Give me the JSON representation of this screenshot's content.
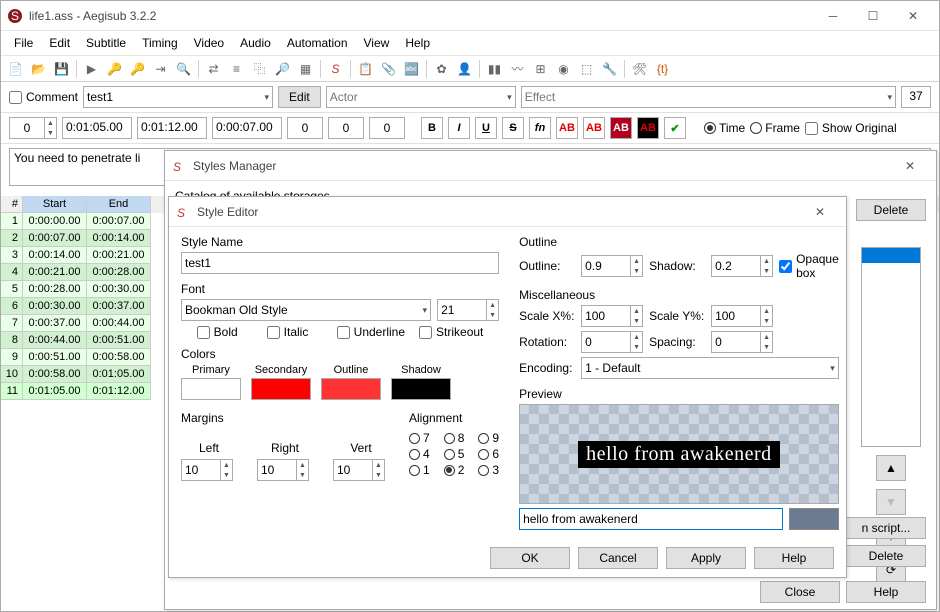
{
  "main": {
    "title": "life1.ass - Aegisub 3.2.2",
    "menus": [
      "File",
      "Edit",
      "Subtitle",
      "Timing",
      "Video",
      "Audio",
      "Automation",
      "View",
      "Help"
    ],
    "comment_label": "Comment",
    "style_selected": "test1",
    "edit_btn": "Edit",
    "actor_placeholder": "Actor",
    "effect_placeholder": "Effect",
    "layer": "37",
    "row": {
      "l": "0",
      "start": "0:01:05.00",
      "end": "0:01:12.00",
      "dur": "0:00:07.00",
      "m1": "0",
      "m2": "0",
      "m3": "0"
    },
    "time_label": "Time",
    "frame_label": "Frame",
    "show_orig": "Show Original",
    "text": "You need to penetrate li",
    "grid_headers": [
      "#",
      "Start",
      "End"
    ],
    "grid": [
      {
        "n": "1",
        "s": "0:00:00.00",
        "e": "0:00:07.00"
      },
      {
        "n": "2",
        "s": "0:00:07.00",
        "e": "0:00:14.00"
      },
      {
        "n": "3",
        "s": "0:00:14.00",
        "e": "0:00:21.00"
      },
      {
        "n": "4",
        "s": "0:00:21.00",
        "e": "0:00:28.00"
      },
      {
        "n": "5",
        "s": "0:00:28.00",
        "e": "0:00:30.00"
      },
      {
        "n": "6",
        "s": "0:00:30.00",
        "e": "0:00:37.00"
      },
      {
        "n": "7",
        "s": "0:00:37.00",
        "e": "0:00:44.00"
      },
      {
        "n": "8",
        "s": "0:00:44.00",
        "e": "0:00:51.00"
      },
      {
        "n": "9",
        "s": "0:00:51.00",
        "e": "0:00:58.00"
      },
      {
        "n": "10",
        "s": "0:00:58.00",
        "e": "0:01:05.00"
      },
      {
        "n": "11",
        "s": "0:01:05.00",
        "e": "0:01:12.00"
      }
    ]
  },
  "styles_manager": {
    "title": "Styles Manager",
    "catalog": "Catalog of available storages",
    "delete": "Delete",
    "script": "n script...",
    "delete2": "Delete",
    "close": "Close",
    "help": "Help"
  },
  "style_editor": {
    "title": "Style Editor",
    "style_name_label": "Style Name",
    "style_name": "test1",
    "font_label": "Font",
    "font_name": "Bookman Old Style",
    "font_size": "21",
    "bold": "Bold",
    "italic": "Italic",
    "underline": "Underline",
    "strikeout": "Strikeout",
    "colors_label": "Colors",
    "color_labels": [
      "Primary",
      "Secondary",
      "Outline",
      "Shadow"
    ],
    "colors": [
      "#ffffff",
      "#ff0000",
      "#ff3333",
      "#000000"
    ],
    "margins_label": "Margins",
    "margin_labels": [
      "Left",
      "Right",
      "Vert"
    ],
    "margins": [
      "10",
      "10",
      "10"
    ],
    "alignment_label": "Alignment",
    "alignment_selected": "2",
    "outline_label": "Outline",
    "outline": "0.9",
    "shadow": "0.2",
    "outline_l": "Outline:",
    "shadow_l": "Shadow:",
    "opaque": "Opaque box",
    "misc_label": "Miscellaneous",
    "scalex_l": "Scale X%:",
    "scalex": "100",
    "scaley_l": "Scale Y%:",
    "scaley": "100",
    "rotation_l": "Rotation:",
    "rotation": "0",
    "spacing_l": "Spacing:",
    "spacing": "0",
    "encoding_l": "Encoding:",
    "encoding": "1 - Default",
    "preview_label": "Preview",
    "preview_text": "hello from awakenerd",
    "ok": "OK",
    "cancel": "Cancel",
    "apply": "Apply",
    "help": "Help"
  }
}
